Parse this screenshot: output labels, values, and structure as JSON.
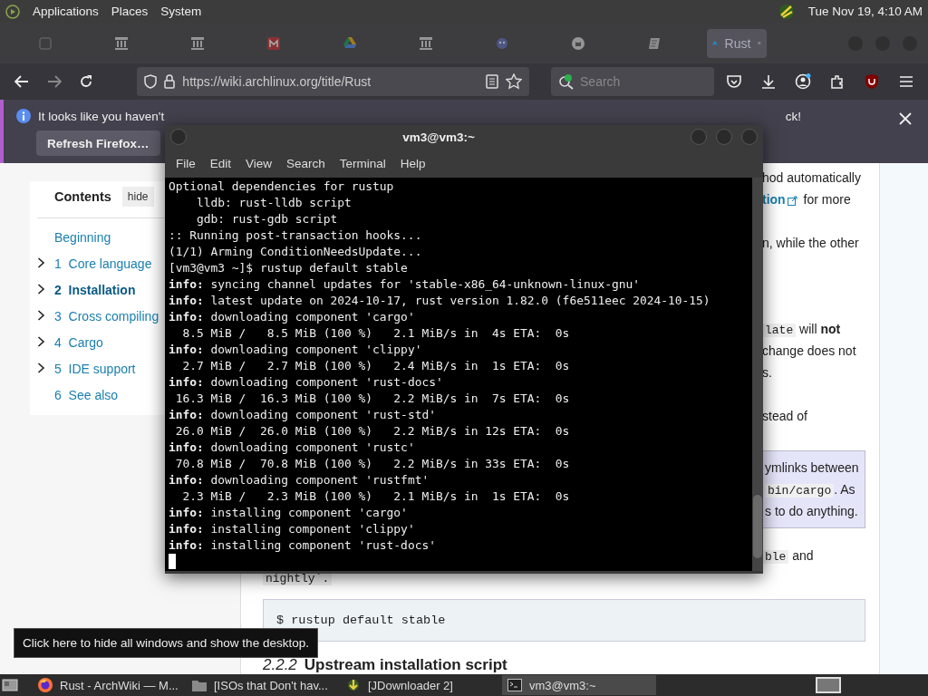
{
  "top_panel": {
    "menus": [
      "Applications",
      "Places",
      "System"
    ],
    "clock": "Tue Nov 19, 4:10 AM"
  },
  "browser": {
    "tabs": [
      {
        "selected": false
      },
      {
        "selected": false
      },
      {
        "selected": false
      },
      {
        "selected": false
      },
      {
        "selected": false
      },
      {
        "selected": false
      },
      {
        "selected": false
      },
      {
        "selected": false
      },
      {
        "selected": false
      },
      {
        "label": "Rust",
        "selected": true
      }
    ],
    "url": "https://wiki.archlinux.org/title/Rust",
    "search": {
      "placeholder": "Search"
    },
    "notice": {
      "text_start": "It looks like you haven't",
      "text_end": "ck!",
      "button": "Refresh Firefox…"
    }
  },
  "wiki": {
    "toc": {
      "title": "Contents",
      "toggle": "hide",
      "items": [
        {
          "title": "Beginning",
          "expandable": false,
          "selected": false
        },
        {
          "number": "1",
          "title": "Core language",
          "expandable": true,
          "selected": false
        },
        {
          "number": "2",
          "title": "Installation",
          "expandable": true,
          "selected": true
        },
        {
          "number": "3",
          "title": "Cross compiling",
          "expandable": true,
          "selected": false
        },
        {
          "number": "4",
          "title": "Cargo",
          "expandable": true,
          "selected": false
        },
        {
          "number": "5",
          "title": "IDE support",
          "expandable": true,
          "selected": false
        },
        {
          "number": "6",
          "title": "See also",
          "expandable": false,
          "selected": false
        }
      ]
    },
    "fragments": [
      {
        "kind": "text",
        "text": "hod automatically"
      },
      {
        "kind": "link",
        "link": "tion",
        "text": " for more"
      },
      {
        "kind": "gap"
      },
      {
        "kind": "text",
        "text": "n, while the other"
      },
      {
        "kind": "gap"
      },
      {
        "kind": "gap"
      },
      {
        "kind": "gap"
      },
      {
        "kind": "code",
        "code": "late",
        "text": " will **not**"
      },
      {
        "kind": "text",
        "text": "change does not"
      },
      {
        "kind": "text",
        "text": "s."
      },
      {
        "kind": "gap"
      },
      {
        "kind": "text",
        "text": "stead of"
      }
    ],
    "note": {
      "lines": [
        {
          "text": "ymlinks between"
        },
        {
          "code": "bin/cargo",
          "text": ". As"
        },
        {
          "text": "s to do anything."
        }
      ]
    },
    "after_note": {
      "code": "ble",
      "text": " and"
    },
    "nightly": "nightly`.",
    "code_block": "$ rustup default stable",
    "heading": {
      "number": "2.2.2",
      "title": "Upstream installation script"
    }
  },
  "terminal": {
    "title": "vm3@vm3:~",
    "menus": [
      "File",
      "Edit",
      "View",
      "Search",
      "Terminal",
      "Help"
    ],
    "lines": [
      "Optional dependencies for rustup",
      "    lldb: rust-lldb script",
      "    gdb: rust-gdb script",
      ":: Running post-transaction hooks...",
      "(1/1) Arming ConditionNeedsUpdate...",
      "[vm3@vm3 ~]$ rustup default stable",
      "**info:** syncing channel updates for 'stable-x86_64-unknown-linux-gnu'",
      "**info:** latest update on 2024-10-17, rust version 1.82.0 (f6e511eec 2024-10-15)",
      "**info:** downloading component 'cargo'",
      "  8.5 MiB /   8.5 MiB (100 %)   2.1 MiB/s in  4s ETA:  0s",
      "**info:** downloading component 'clippy'",
      "  2.7 MiB /   2.7 MiB (100 %)   2.4 MiB/s in  1s ETA:  0s",
      "**info:** downloading component 'rust-docs'",
      " 16.3 MiB /  16.3 MiB (100 %)   2.2 MiB/s in  7s ETA:  0s",
      "**info:** downloading component 'rust-std'",
      " 26.0 MiB /  26.0 MiB (100 %)   2.2 MiB/s in 12s ETA:  0s",
      "**info:** downloading component 'rustc'",
      " 70.8 MiB /  70.8 MiB (100 %)   2.2 MiB/s in 33s ETA:  0s",
      "**info:** downloading component 'rustfmt'",
      "  2.3 MiB /   2.3 MiB (100 %)   2.1 MiB/s in  1s ETA:  0s",
      "**info:** installing component 'cargo'",
      "**info:** installing component 'clippy'",
      "**info:** installing component 'rust-docs'"
    ]
  },
  "tooltip": "Click here to hide all windows and show the desktop.",
  "taskbar": {
    "tasks": [
      {
        "kind": "firefox",
        "label": "Rust - ArchWiki — M...",
        "selected": false
      },
      {
        "kind": "folder",
        "label": "[ISOs that Don't hav...",
        "selected": false
      },
      {
        "kind": "jdownloader",
        "label": "[JDownloader 2]",
        "selected": false
      },
      {
        "kind": "terminal",
        "label": "vm3@vm3:~",
        "selected": true
      }
    ]
  }
}
